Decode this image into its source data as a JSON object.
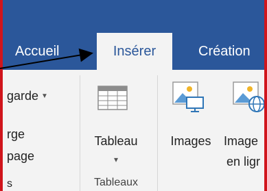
{
  "ribbon": {
    "tabs": [
      {
        "label": "Accueil"
      },
      {
        "label": "Insérer"
      },
      {
        "label": "Création"
      }
    ]
  },
  "left_panel": {
    "items": [
      "garde",
      "rge",
      "page",
      "s"
    ]
  },
  "tableau": {
    "label": "Tableau",
    "dropdown_glyph": "▾"
  },
  "images": {
    "label": "Images"
  },
  "online_images": {
    "label_line1": "Image",
    "label_line2": "en ligr"
  },
  "groups": {
    "tableaux_label": "Tableaux"
  },
  "colors": {
    "ribbon_blue": "#2b579a",
    "frame_red": "#d0151c",
    "ribbon_bg": "#f3f3f3"
  },
  "icons": [
    "table-icon",
    "picture-computer-icon",
    "picture-globe-icon",
    "dropdown-caret-icon",
    "annotation-arrow"
  ]
}
